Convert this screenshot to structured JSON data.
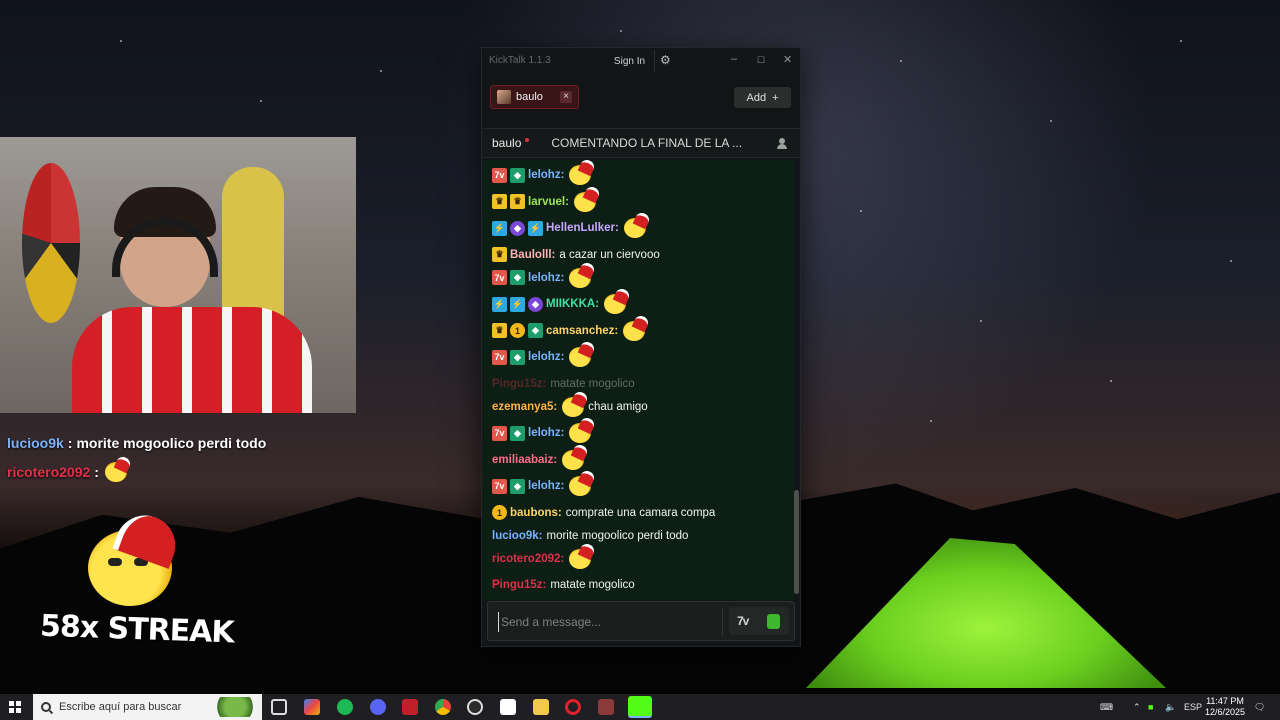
{
  "overlay": {
    "chat": [
      {
        "user": "lucioo9k",
        "sep": ":",
        "message": "morite mogoolico perdi todo",
        "color": "blue"
      },
      {
        "user": "ricotero2092",
        "sep": ":",
        "message": "",
        "color": "red",
        "emote": "xmas-emote"
      }
    ],
    "streak": "58x STREAK"
  },
  "app": {
    "title": "KickTalk 1.1.3",
    "signin_label": "Sign In",
    "tab": {
      "label": "baulo",
      "close": "×"
    },
    "add_label": "Add",
    "add_icon": "+",
    "channel": {
      "name": "baulo",
      "stream_title": "COMENTANDO LA FINAL DE LA ..."
    },
    "messages": [
      {
        "user": "lelohz:",
        "color": "#7ab3ff",
        "badges": [
          "kick",
          "green"
        ],
        "text": "",
        "emote": true
      },
      {
        "user": "larvuel:",
        "color": "#9ee35a",
        "badges": [
          "gold",
          "gold"
        ],
        "text": "",
        "emote": true
      },
      {
        "user": "HellenLulker:",
        "color": "#c7a6ff",
        "badges": [
          "blue",
          "purple",
          "blue"
        ],
        "text": "",
        "emote": true
      },
      {
        "user": "Baulolll:",
        "color": "#ffb3b3",
        "badges": [
          "gold"
        ],
        "text": "a cazar un ciervooo",
        "emote": false
      },
      {
        "user": "lelohz:",
        "color": "#7ab3ff",
        "badges": [
          "kick",
          "green"
        ],
        "text": "",
        "emote": true
      },
      {
        "user": "MIIKKKA:",
        "color": "#41e0a2",
        "badges": [
          "blue",
          "blue",
          "purple"
        ],
        "text": "",
        "emote": true
      },
      {
        "user": "camsanchez:",
        "color": "#ffd36a",
        "badges": [
          "gold",
          "coin",
          "green"
        ],
        "text": "",
        "emote": true
      },
      {
        "user": "lelohz:",
        "color": "#7ab3ff",
        "badges": [
          "kick",
          "green"
        ],
        "text": "",
        "emote": true
      },
      {
        "user": "Pingu15z:",
        "color": "#e0304a",
        "badges": [],
        "text": "matate mogolico",
        "emote": false,
        "faded": true
      },
      {
        "user": "ezemanya5:",
        "color": "#ffb347",
        "badges": [],
        "text": "chau amigo",
        "emote": true
      },
      {
        "user": "lelohz:",
        "color": "#7ab3ff",
        "badges": [
          "kick",
          "green"
        ],
        "text": "",
        "emote": true
      },
      {
        "user": "emiliaabaiz:",
        "color": "#ff6f8a",
        "badges": [],
        "text": "",
        "emote": true
      },
      {
        "user": "lelohz:",
        "color": "#7ab3ff",
        "badges": [
          "kick",
          "green"
        ],
        "text": "",
        "emote": true
      },
      {
        "user": "baubons:",
        "color": "#ffd36a",
        "badges": [
          "coin"
        ],
        "text": "comprate una camara compa",
        "emote": false
      },
      {
        "user": "lucioo9k:",
        "color": "#7ab3ff",
        "badges": [],
        "text": "morite mogoolico perdi todo",
        "emote": false
      },
      {
        "user": "ricotero2092:",
        "color": "#e0304a",
        "badges": [],
        "text": "",
        "emote": true
      },
      {
        "user": "Pingu15z:",
        "color": "#e0304a",
        "badges": [],
        "text": "matate mogolico",
        "emote": false
      }
    ],
    "input_placeholder": "Send a message...",
    "seventv_label": "7tv"
  },
  "taskbar": {
    "search_placeholder": "Escribe aquí para buscar",
    "lang": "ESP",
    "time": "11:47 PM",
    "date": "12/6/2025"
  }
}
